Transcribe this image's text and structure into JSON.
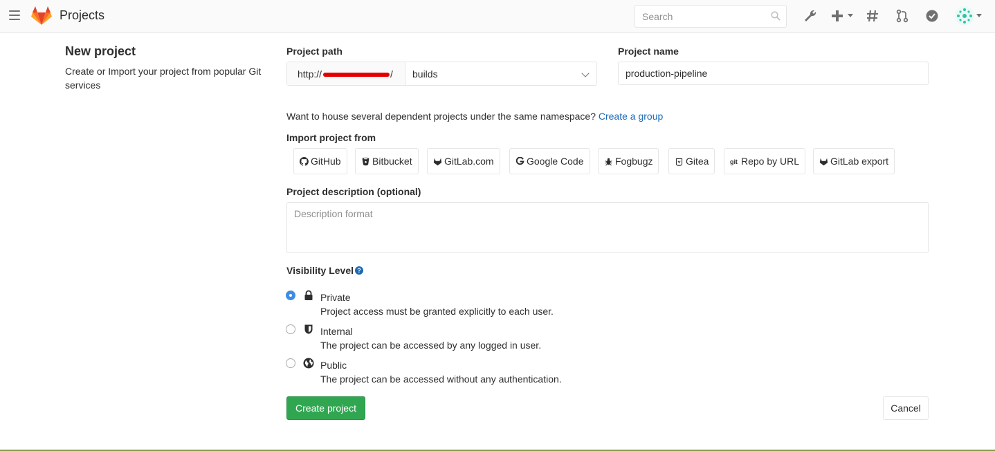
{
  "header": {
    "app_title": "Projects",
    "search_placeholder": "Search",
    "icons": [
      "menu-icon",
      "gitlab-logo",
      "search-icon",
      "wrench-icon",
      "plus-icon",
      "hash-icon",
      "merge-request-icon",
      "todo-check-icon",
      "avatar"
    ]
  },
  "sidebar": {
    "title": "New project",
    "description": "Create or Import your project from popular Git services"
  },
  "form": {
    "path_label": "Project path",
    "path_prefix": "http://",
    "path_suffix": "/",
    "namespace": "builds",
    "name_label": "Project name",
    "name_value": "production-pipeline",
    "group_hint": "Want to house several dependent projects under the same namespace? ",
    "group_link": "Create a group",
    "import_label": "Import project from",
    "import_sources": [
      {
        "label": "GitHub",
        "icon": "github-icon"
      },
      {
        "label": "Bitbucket",
        "icon": "bitbucket-icon"
      },
      {
        "label": "GitLab.com",
        "icon": "gitlab-icon"
      },
      {
        "label": "Google Code",
        "icon": "google-icon"
      },
      {
        "label": "Fogbugz",
        "icon": "bug-icon"
      },
      {
        "label": "Gitea",
        "icon": "gitea-icon"
      },
      {
        "label": "Repo by URL",
        "icon": "git-icon"
      },
      {
        "label": "GitLab export",
        "icon": "gitlab-icon"
      }
    ],
    "description_label": "Project description (optional)",
    "description_placeholder": "Description format",
    "visibility_label": "Visibility Level",
    "visibility_help": "?",
    "visibility_options": [
      {
        "title": "Private",
        "description": "Project access must be granted explicitly to each user.",
        "checked": true,
        "icon": "lock-icon"
      },
      {
        "title": "Internal",
        "description": "The project can be accessed by any logged in user.",
        "checked": false,
        "icon": "shield-icon"
      },
      {
        "title": "Public",
        "description": "The project can be accessed without any authentication.",
        "checked": false,
        "icon": "globe-icon"
      }
    ],
    "create_label": "Create project",
    "cancel_label": "Cancel"
  },
  "colors": {
    "primary": "#31a651",
    "link": "#1b69b6",
    "radio_checked": "#3d8de8",
    "redaction": "#e50000"
  }
}
